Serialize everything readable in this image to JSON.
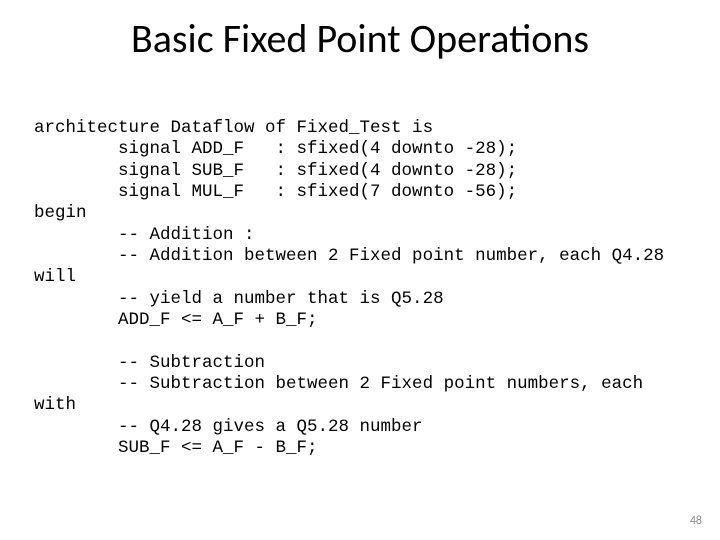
{
  "title": "Basic Fixed Point Operations",
  "code": {
    "l1": "architecture Dataflow of Fixed_Test is",
    "l2": "        signal ADD_F   : sfixed(4 downto -28);",
    "l3": "        signal SUB_F   : sfixed(4 downto -28);",
    "l4": "        signal MUL_F   : sfixed(7 downto -56);",
    "l5": "begin",
    "l6": "        -- Addition :",
    "l7": "        -- Addition between 2 Fixed point number, each Q4.28",
    "l8": "will",
    "l9": "        -- yield a number that is Q5.28",
    "l10": "        ADD_F <= A_F + B_F;",
    "l11": "",
    "l12": "        -- Subtraction",
    "l13": "        -- Subtraction between 2 Fixed point numbers, each",
    "l14": "with",
    "l15": "        -- Q4.28 gives a Q5.28 number",
    "l16": "        SUB_F <= A_F - B_F;"
  },
  "page_number": "48"
}
